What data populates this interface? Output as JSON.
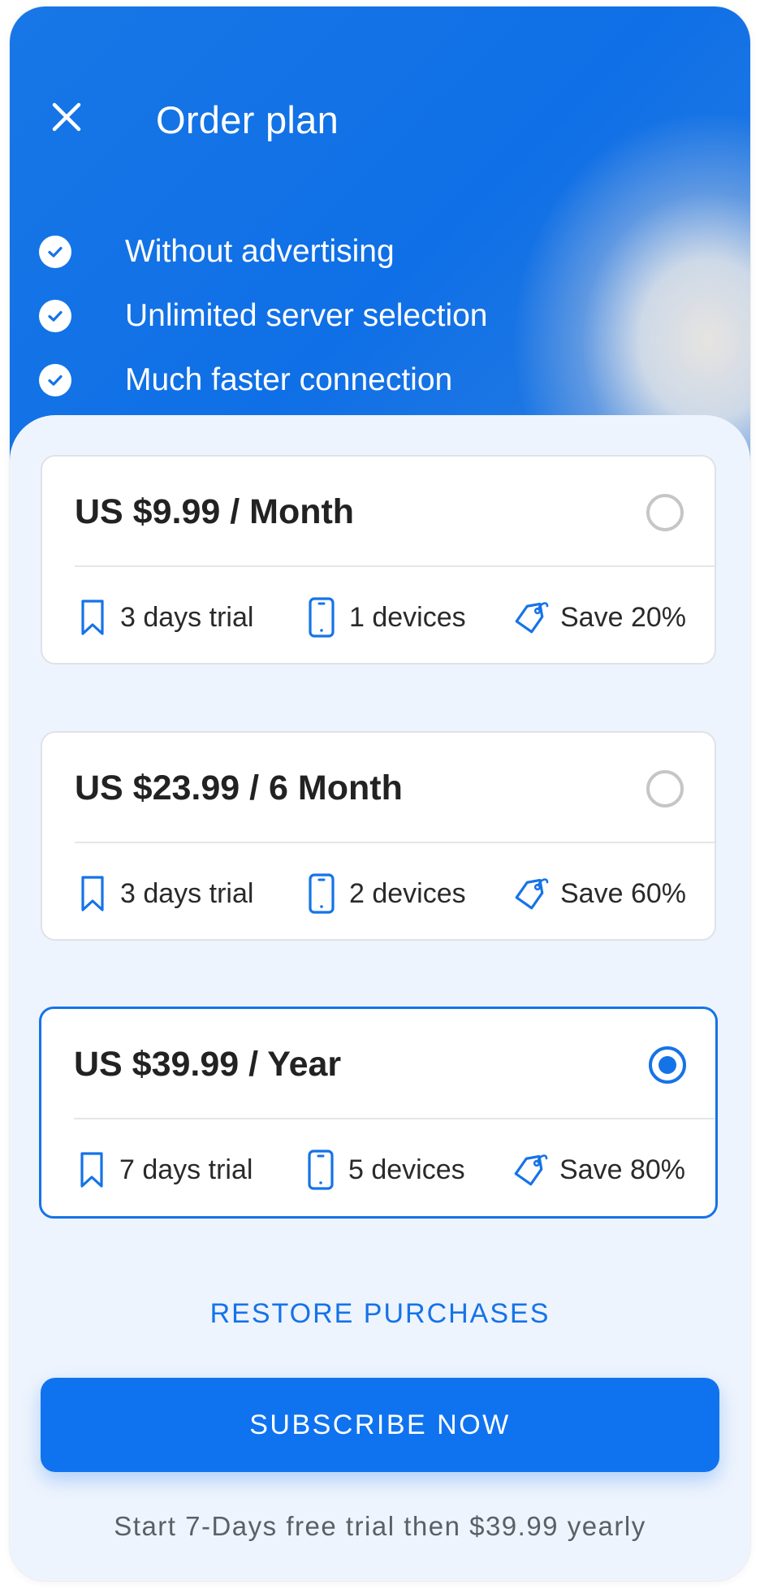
{
  "header": {
    "title": "Order plan",
    "close_icon": "close-icon"
  },
  "features": [
    {
      "label": "Without advertising",
      "icon": "check-circle-icon"
    },
    {
      "label": "Unlimited server selection",
      "icon": "check-circle-icon"
    },
    {
      "label": "Much faster connection",
      "icon": "check-circle-icon"
    }
  ],
  "plans": [
    {
      "price": "US $9.99 / Month",
      "trial": "3 days trial",
      "devices": "1 devices",
      "save": "Save 20%",
      "selected": false
    },
    {
      "price": "US $23.99 / 6 Month",
      "trial": "3 days trial",
      "devices": "2 devices",
      "save": "Save 60%",
      "selected": false
    },
    {
      "price": "US $39.99 / Year",
      "trial": "7 days trial",
      "devices": "5 devices",
      "save": "Save 80%",
      "selected": true
    }
  ],
  "icons": {
    "trial": "bookmark-icon",
    "devices": "smartphone-icon",
    "save": "price-tag-icon"
  },
  "restore_label": "RESTORE PURCHASES",
  "subscribe_label": "SUBSCRIBE NOW",
  "footnote": "Start 7-Days free trial then $39.99 yearly",
  "colors": {
    "accent": "#1573E8",
    "header_blue": "#0F6FE6",
    "background": "#EEF4FD"
  }
}
